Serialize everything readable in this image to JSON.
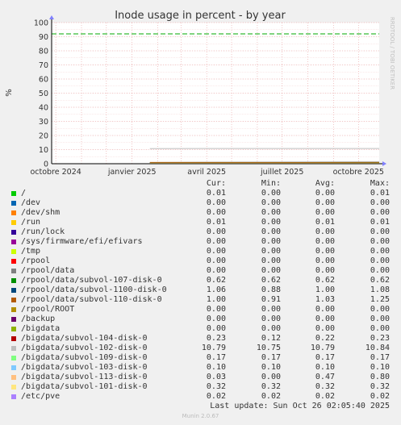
{
  "chart_data": {
    "type": "line",
    "title": "Inode usage in percent - by year",
    "ylabel": "%",
    "ylim": [
      0,
      100
    ],
    "yticks": [
      0,
      10,
      20,
      30,
      40,
      50,
      60,
      70,
      80,
      90,
      100
    ],
    "xticks": [
      "octobre 2024",
      "janvier 2025",
      "avril 2025",
      "juillet 2025",
      "octobre 2025"
    ],
    "xlim": [
      "2024-09-26",
      "2025-10-26"
    ],
    "warning_line": 92,
    "grid": true,
    "series": [
      {
        "name": "/",
        "color": "#00cc00",
        "values": [
          [
            0,
            0
          ],
          [
            0.29,
            0
          ],
          [
            0.3,
            0.01
          ],
          [
            1,
            0.01
          ]
        ]
      },
      {
        "name": "/dev",
        "color": "#0066b3",
        "values": [
          [
            0.3,
            0
          ],
          [
            1,
            0
          ]
        ]
      },
      {
        "name": "/dev/shm",
        "color": "#ff8000",
        "values": [
          [
            0.3,
            0
          ],
          [
            1,
            0
          ]
        ]
      },
      {
        "name": "/run",
        "color": "#ffcc00",
        "values": [
          [
            0.3,
            0.01
          ],
          [
            1,
            0.01
          ]
        ]
      },
      {
        "name": "/run/lock",
        "color": "#330099",
        "values": [
          [
            0.3,
            0
          ],
          [
            1,
            0
          ]
        ]
      },
      {
        "name": "/sys/firmware/efi/efivars",
        "color": "#990099",
        "values": [
          [
            0.3,
            0
          ],
          [
            1,
            0
          ]
        ]
      },
      {
        "name": "/tmp",
        "color": "#ccff00",
        "values": [
          [
            0.3,
            0
          ],
          [
            1,
            0
          ]
        ]
      },
      {
        "name": "/rpool",
        "color": "#ff0000",
        "values": [
          [
            0.3,
            0
          ],
          [
            1,
            0
          ]
        ]
      },
      {
        "name": "/rpool/data",
        "color": "#808080",
        "values": [
          [
            0.3,
            0
          ],
          [
            1,
            0
          ]
        ]
      },
      {
        "name": "/rpool/data/subvol-107-disk-0",
        "color": "#008f00",
        "values": [
          [
            0.3,
            0.62
          ],
          [
            1,
            0.62
          ]
        ]
      },
      {
        "name": "/rpool/data/subvol-1100-disk-0",
        "color": "#00487d",
        "values": [
          [
            0.3,
            0.88
          ],
          [
            1,
            1.06
          ]
        ]
      },
      {
        "name": "/rpool/data/subvol-110-disk-0",
        "color": "#b35a00",
        "values": [
          [
            0.3,
            0.91
          ],
          [
            1,
            1.0
          ]
        ]
      },
      {
        "name": "/rpool/ROOT",
        "color": "#b38f00",
        "values": [
          [
            0.3,
            0
          ],
          [
            1,
            0
          ]
        ]
      },
      {
        "name": "/backup",
        "color": "#6b006b",
        "values": [
          [
            0.3,
            0
          ],
          [
            1,
            0
          ]
        ]
      },
      {
        "name": "/bigdata",
        "color": "#8fb300",
        "values": [
          [
            0.3,
            0
          ],
          [
            1,
            0
          ]
        ]
      },
      {
        "name": "/bigdata/subvol-104-disk-0",
        "color": "#b30000",
        "values": [
          [
            0.3,
            0.12
          ],
          [
            1,
            0.23
          ]
        ]
      },
      {
        "name": "/bigdata/subvol-102-disk-0",
        "color": "#bebebe",
        "values": [
          [
            0.3,
            10.75
          ],
          [
            1,
            10.79
          ]
        ]
      },
      {
        "name": "/bigdata/subvol-109-disk-0",
        "color": "#80ff80",
        "values": [
          [
            0.3,
            0.17
          ],
          [
            1,
            0.17
          ]
        ]
      },
      {
        "name": "/bigdata/subvol-103-disk-0",
        "color": "#80c9ff",
        "values": [
          [
            0.3,
            0.1
          ],
          [
            1,
            0.1
          ]
        ]
      },
      {
        "name": "/bigdata/subvol-113-disk-0",
        "color": "#ffc080",
        "values": [
          [
            0.3,
            0.0
          ],
          [
            1,
            0.03
          ]
        ]
      },
      {
        "name": "/bigdata/subvol-101-disk-0",
        "color": "#ffe680",
        "values": [
          [
            0.3,
            0.32
          ],
          [
            1,
            0.32
          ]
        ]
      },
      {
        "name": "/etc/pve",
        "color": "#aa80ff",
        "values": [
          [
            0.3,
            0.02
          ],
          [
            1,
            0.02
          ]
        ]
      }
    ]
  },
  "watermark": "RRDTOOL / TOBI OETIKER",
  "table": {
    "headers": [
      "Cur:",
      "Min:",
      "Avg:",
      "Max:"
    ],
    "rows": [
      {
        "label": "/",
        "cur": "0.01",
        "min": "0.00",
        "avg": "0.00",
        "max": "0.01"
      },
      {
        "label": "/dev",
        "cur": "0.00",
        "min": "0.00",
        "avg": "0.00",
        "max": "0.00"
      },
      {
        "label": "/dev/shm",
        "cur": "0.00",
        "min": "0.00",
        "avg": "0.00",
        "max": "0.00"
      },
      {
        "label": "/run",
        "cur": "0.01",
        "min": "0.00",
        "avg": "0.01",
        "max": "0.01"
      },
      {
        "label": "/run/lock",
        "cur": "0.00",
        "min": "0.00",
        "avg": "0.00",
        "max": "0.00"
      },
      {
        "label": "/sys/firmware/efi/efivars",
        "cur": "0.00",
        "min": "0.00",
        "avg": "0.00",
        "max": "0.00"
      },
      {
        "label": "/tmp",
        "cur": "0.00",
        "min": "0.00",
        "avg": "0.00",
        "max": "0.00"
      },
      {
        "label": "/rpool",
        "cur": "0.00",
        "min": "0.00",
        "avg": "0.00",
        "max": "0.00"
      },
      {
        "label": "/rpool/data",
        "cur": "0.00",
        "min": "0.00",
        "avg": "0.00",
        "max": "0.00"
      },
      {
        "label": "/rpool/data/subvol-107-disk-0",
        "cur": "0.62",
        "min": "0.62",
        "avg": "0.62",
        "max": "0.62"
      },
      {
        "label": "/rpool/data/subvol-1100-disk-0",
        "cur": "1.06",
        "min": "0.88",
        "avg": "1.00",
        "max": "1.08"
      },
      {
        "label": "/rpool/data/subvol-110-disk-0",
        "cur": "1.00",
        "min": "0.91",
        "avg": "1.03",
        "max": "1.25"
      },
      {
        "label": "/rpool/ROOT",
        "cur": "0.00",
        "min": "0.00",
        "avg": "0.00",
        "max": "0.00"
      },
      {
        "label": "/backup",
        "cur": "0.00",
        "min": "0.00",
        "avg": "0.00",
        "max": "0.00"
      },
      {
        "label": "/bigdata",
        "cur": "0.00",
        "min": "0.00",
        "avg": "0.00",
        "max": "0.00"
      },
      {
        "label": "/bigdata/subvol-104-disk-0",
        "cur": "0.23",
        "min": "0.12",
        "avg": "0.22",
        "max": "0.23"
      },
      {
        "label": "/bigdata/subvol-102-disk-0",
        "cur": "10.79",
        "min": "10.75",
        "avg": "10.79",
        "max": "10.84"
      },
      {
        "label": "/bigdata/subvol-109-disk-0",
        "cur": "0.17",
        "min": "0.17",
        "avg": "0.17",
        "max": "0.17"
      },
      {
        "label": "/bigdata/subvol-103-disk-0",
        "cur": "0.10",
        "min": "0.10",
        "avg": "0.10",
        "max": "0.10"
      },
      {
        "label": "/bigdata/subvol-113-disk-0",
        "cur": "0.03",
        "min": "0.00",
        "avg": "0.47",
        "max": "0.80"
      },
      {
        "label": "/bigdata/subvol-101-disk-0",
        "cur": "0.32",
        "min": "0.32",
        "avg": "0.32",
        "max": "0.32"
      },
      {
        "label": "/etc/pve",
        "cur": "0.02",
        "min": "0.02",
        "avg": "0.02",
        "max": "0.02"
      }
    ]
  },
  "footer": "Last update: Sun Oct 26 02:05:40 2025",
  "munin": "Munin 2.0.67"
}
